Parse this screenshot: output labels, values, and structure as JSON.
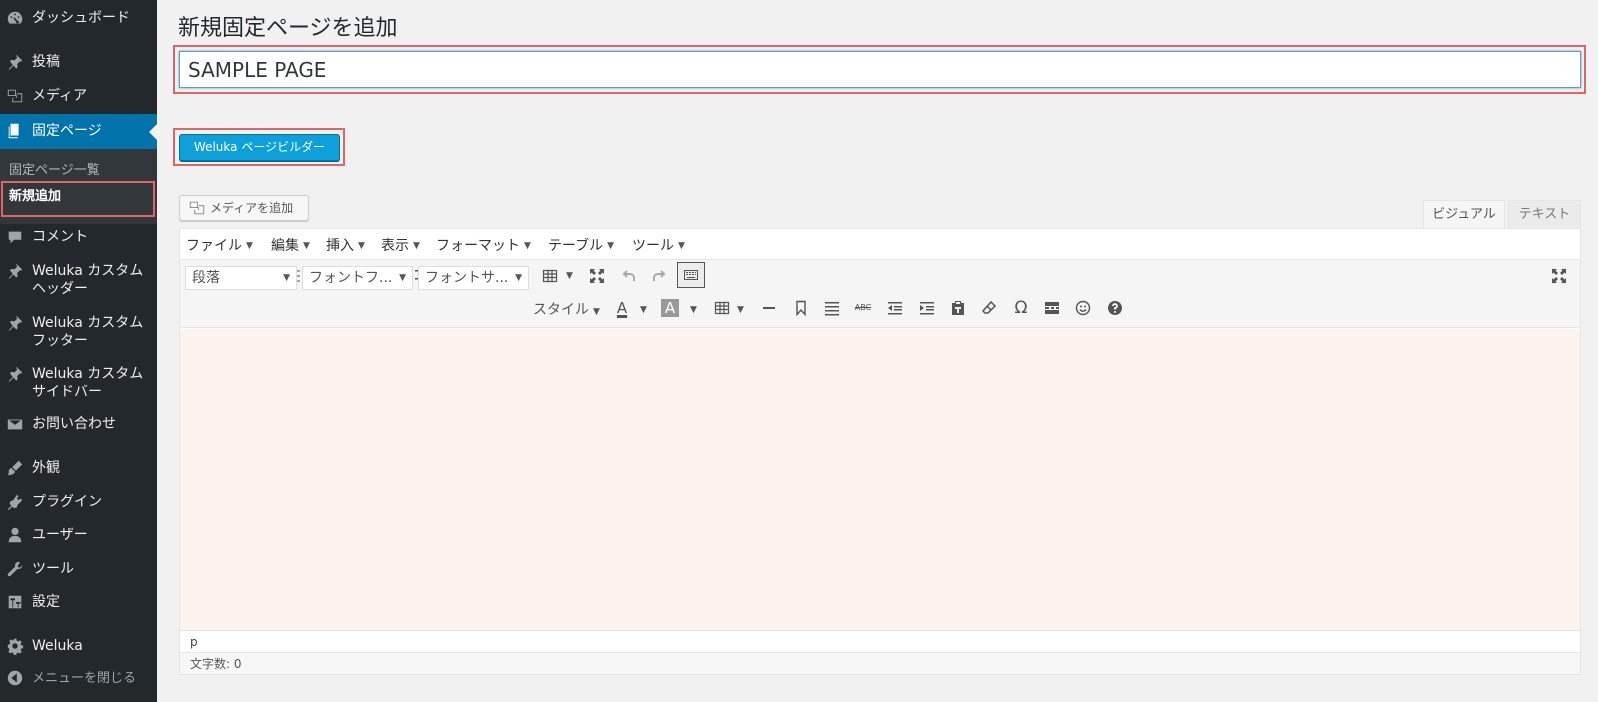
{
  "sidebar": {
    "items": [
      {
        "label": "ダッシュボード",
        "icon": "dashboard-icon"
      },
      {
        "label": "投稿",
        "icon": "pin-icon"
      },
      {
        "label": "メディア",
        "icon": "media-icon"
      },
      {
        "label": "固定ページ",
        "icon": "page-icon"
      },
      {
        "label": "コメント",
        "icon": "comment-icon"
      },
      {
        "label": "Weluka カスタムヘッダー",
        "icon": "pin-icon"
      },
      {
        "label": "Weluka カスタムフッター",
        "icon": "pin-icon"
      },
      {
        "label": "Weluka カスタムサイドバー",
        "icon": "pin-icon"
      },
      {
        "label": "お問い合わせ",
        "icon": "mail-icon"
      },
      {
        "label": "外観",
        "icon": "brush-icon"
      },
      {
        "label": "プラグイン",
        "icon": "plugin-icon"
      },
      {
        "label": "ユーザー",
        "icon": "user-icon"
      },
      {
        "label": "ツール",
        "icon": "wrench-icon"
      },
      {
        "label": "設定",
        "icon": "settings-icon"
      },
      {
        "label": "Weluka",
        "icon": "gear-icon"
      }
    ],
    "submenu": [
      "固定ページ一覧",
      "新規追加"
    ],
    "collapse_label": "メニューを閉じる"
  },
  "main": {
    "page_title": "新規固定ページを追加",
    "title_value": "SAMPLE PAGE",
    "builder_button": "Weluka ページビルダー",
    "add_media": "メディアを追加",
    "tabs": {
      "visual": "ビジュアル",
      "text": "テキスト"
    }
  },
  "editor": {
    "menubar": [
      "ファイル",
      "編集",
      "挿入",
      "表示",
      "フォーマット",
      "テーブル",
      "ツール"
    ],
    "format_select": "段落",
    "font_family_select": "フォントフ...",
    "font_size_select": "フォントサ...",
    "style_select": "スタイル",
    "status_path": "p",
    "word_count": "文字数: 0"
  },
  "colors": {
    "sidebar_bg": "#23282d",
    "accent": "#0073aa",
    "button_blue": "#0ea0d8",
    "highlight_red": "#e06666",
    "editor_content_bg": "#fdf2ed"
  }
}
